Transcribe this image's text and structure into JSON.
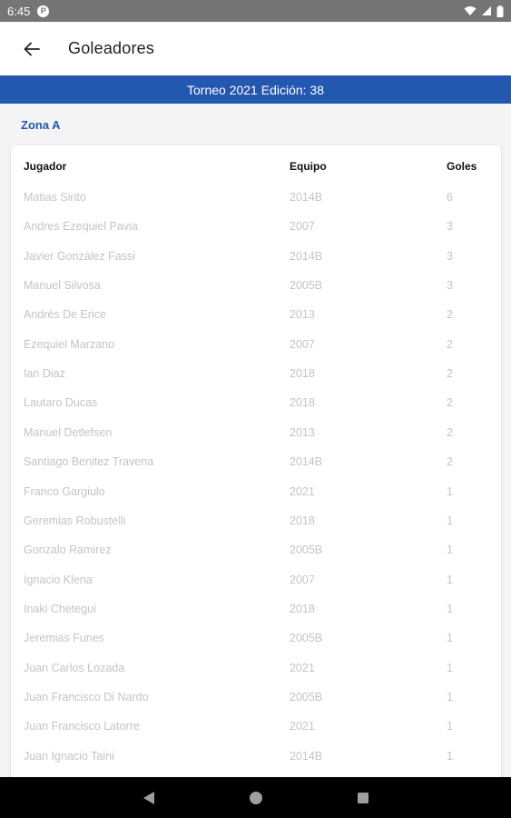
{
  "status_bar": {
    "time": "6:45",
    "notification_letter": "P"
  },
  "app_bar": {
    "title": "Goleadores"
  },
  "banner": {
    "text": "Torneo 2021 Edición: 38"
  },
  "zone": {
    "title": "Zona A"
  },
  "table": {
    "headers": {
      "player": "Jugador",
      "team": "Equipo",
      "goals": "Goles"
    },
    "rows": [
      {
        "player": "Matias Sirito",
        "team": "2014B",
        "goals": "6"
      },
      {
        "player": "Andres Ezequiel Pavia",
        "team": "2007",
        "goals": "3"
      },
      {
        "player": "Javier González Fassi",
        "team": "2014B",
        "goals": "3"
      },
      {
        "player": "Manuel Silvosa",
        "team": "2005B",
        "goals": "3"
      },
      {
        "player": "Andrés De Erice",
        "team": "2013",
        "goals": "2"
      },
      {
        "player": "Ezequiel Marzano",
        "team": "2007",
        "goals": "2"
      },
      {
        "player": "Ian Diaz",
        "team": "2018",
        "goals": "2"
      },
      {
        "player": "Lautaro Ducas",
        "team": "2018",
        "goals": "2"
      },
      {
        "player": "Manuel Detlefsen",
        "team": "2013",
        "goals": "2"
      },
      {
        "player": "Santiago Benitez Travena",
        "team": "2014B",
        "goals": "2"
      },
      {
        "player": "Franco Gargiulo",
        "team": "2021",
        "goals": "1"
      },
      {
        "player": "Geremias Robustelli",
        "team": "2018",
        "goals": "1"
      },
      {
        "player": "Gonzalo Ramirez",
        "team": "2005B",
        "goals": "1"
      },
      {
        "player": "Ignacio Klena",
        "team": "2007",
        "goals": "1"
      },
      {
        "player": "Inaki Chetegui",
        "team": "2018",
        "goals": "1"
      },
      {
        "player": "Jeremias Funes",
        "team": "2005B",
        "goals": "1"
      },
      {
        "player": "Juan Carlos Lozada",
        "team": "2021",
        "goals": "1"
      },
      {
        "player": "Juan Francisco Di Nardo",
        "team": "2005B",
        "goals": "1"
      },
      {
        "player": "Juan Francisco Latorre",
        "team": "2021",
        "goals": "1"
      },
      {
        "player": "Juan Ignacio Taini",
        "team": "2014B",
        "goals": "1"
      }
    ]
  },
  "colors": {
    "accent": "#2357b0",
    "row_text": "#c4c4c4",
    "status_bar": "#757575",
    "nav_bar": "#000000"
  },
  "icons": {
    "back": "arrow-left-icon",
    "wifi": "wifi-icon",
    "signal": "signal-icon",
    "battery": "battery-icon",
    "nav_back": "triangle-back-icon",
    "nav_home": "circle-home-icon",
    "nav_recents": "square-recents-icon"
  }
}
